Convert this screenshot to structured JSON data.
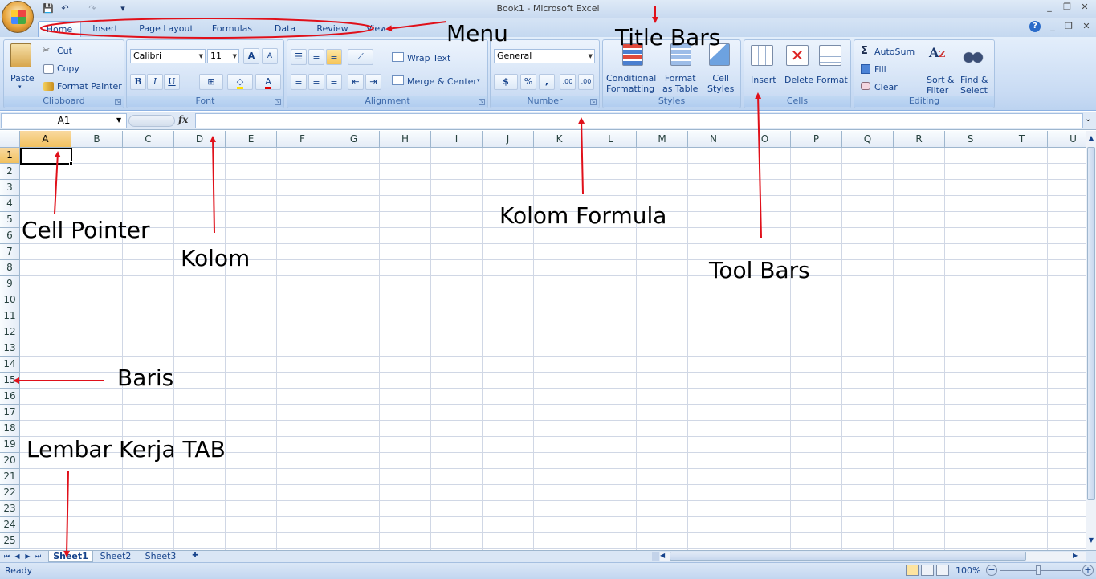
{
  "window": {
    "title": "Book1 - Microsoft Excel",
    "controls": [
      "_",
      "❐",
      "✕"
    ],
    "ribbon_controls": [
      "?",
      "_",
      "❐",
      "✕"
    ]
  },
  "qat": {
    "save": "💾",
    "undo": "↶",
    "redo": "↷",
    "customize": "▾"
  },
  "menu": {
    "tabs": [
      "Home",
      "Insert",
      "Page Layout",
      "Formulas",
      "Data",
      "Review",
      "View"
    ]
  },
  "ribbon": {
    "clipboard": {
      "label": "Clipboard",
      "paste": "Paste",
      "cut": "Cut",
      "copy": "Copy",
      "format_painter": "Format Painter"
    },
    "font": {
      "label": "Font",
      "family": "Calibri",
      "size": "11",
      "bold": "B",
      "italic": "I",
      "underline": "U",
      "grow": "A",
      "shrink": "A",
      "font_color": "A"
    },
    "alignment": {
      "label": "Alignment",
      "wrap_text": "Wrap Text",
      "merge_center": "Merge & Center"
    },
    "number": {
      "label": "Number",
      "format": "General",
      "currency": "$",
      "percent": "%",
      "comma": ",",
      "inc_decimal": ".00",
      "dec_decimal": ".00"
    },
    "styles": {
      "label": "Styles",
      "conditional_1": "Conditional",
      "conditional_2": "Formatting",
      "format_table_1": "Format",
      "format_table_2": "as Table",
      "cell_styles_1": "Cell",
      "cell_styles_2": "Styles"
    },
    "cells": {
      "label": "Cells",
      "insert": "Insert",
      "delete": "Delete",
      "format": "Format"
    },
    "editing": {
      "label": "Editing",
      "autosum": "AutoSum",
      "fill": "Fill",
      "clear": "Clear",
      "sort_1": "Sort &",
      "sort_2": "Filter",
      "find_1": "Find &",
      "find_2": "Select",
      "sigma": "Σ"
    }
  },
  "formula_bar": {
    "name_box": "A1",
    "fx": "fx",
    "value": ""
  },
  "grid": {
    "columns": [
      "A",
      "B",
      "C",
      "D",
      "E",
      "F",
      "G",
      "H",
      "I",
      "J",
      "K",
      "L",
      "M",
      "N",
      "O",
      "P",
      "Q",
      "R",
      "S",
      "T",
      "U"
    ],
    "rows": [
      "1",
      "2",
      "3",
      "4",
      "5",
      "6",
      "7",
      "8",
      "9",
      "10",
      "11",
      "12",
      "13",
      "14",
      "15",
      "16",
      "17",
      "18",
      "19",
      "20",
      "21",
      "22",
      "23",
      "24",
      "25"
    ],
    "selected_cell": "A1"
  },
  "sheets": {
    "tabs": [
      "Sheet1",
      "Sheet2",
      "Sheet3"
    ],
    "active": "Sheet1"
  },
  "status": {
    "text": "Ready",
    "zoom": "100%"
  },
  "annotations": {
    "menu": "Menu",
    "title_bars": "Title Bars",
    "kolom_formula": "Kolom Formula",
    "tool_bars": "Tool Bars",
    "cell_pointer": "Cell Pointer",
    "kolom": "Kolom",
    "baris": "Baris",
    "lembar_kerja_tab": "Lembar Kerja TAB"
  },
  "colors": {
    "annotation_arrow": "#e0101a",
    "ribbon_text": "#15428b"
  }
}
